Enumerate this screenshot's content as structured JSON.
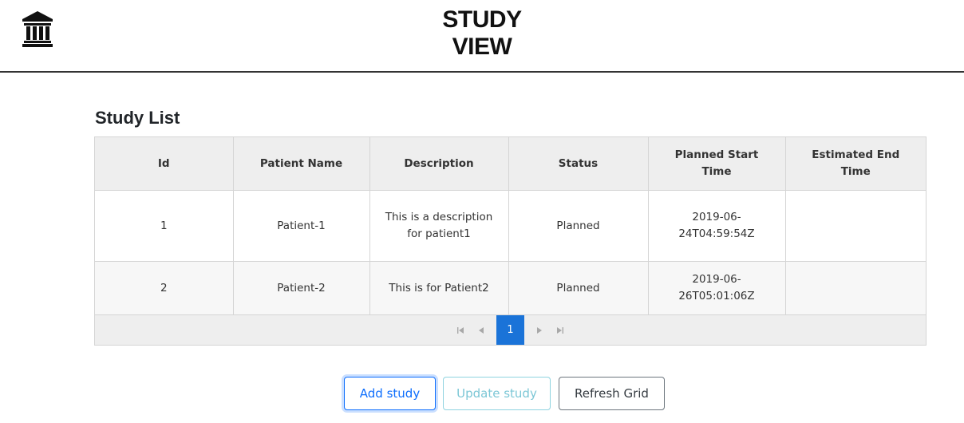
{
  "header": {
    "title": "STUDY\nVIEW",
    "logo_icon": "bank-building-icon"
  },
  "study_list": {
    "title": "Study List",
    "columns": [
      "Id",
      "Patient Name",
      "Description",
      "Status",
      "Planned Start\nTime",
      "Estimated End\nTime"
    ],
    "rows": [
      {
        "id": "1",
        "patient_name": "Patient-1",
        "description": "This is a description for patient1",
        "status": "Planned",
        "planned_start": "2019-06-24T04:59:54Z",
        "estimated_end": ""
      },
      {
        "id": "2",
        "patient_name": "Patient-2",
        "description": "This is for Patient2",
        "status": "Planned",
        "planned_start": "2019-06-26T05:01:06Z",
        "estimated_end": ""
      }
    ]
  },
  "pager": {
    "first_icon": "first-page-icon",
    "prev_icon": "previous-page-icon",
    "current_page": "1",
    "next_icon": "next-page-icon",
    "last_icon": "last-page-icon"
  },
  "actions": {
    "add_label": "Add study",
    "update_label": "Update study",
    "refresh_label": "Refresh Grid"
  },
  "colors": {
    "accent": "#1a73d8",
    "add_border": "#0d6efd",
    "update_text": "#7cc7d6",
    "header_rule": "#333333"
  }
}
